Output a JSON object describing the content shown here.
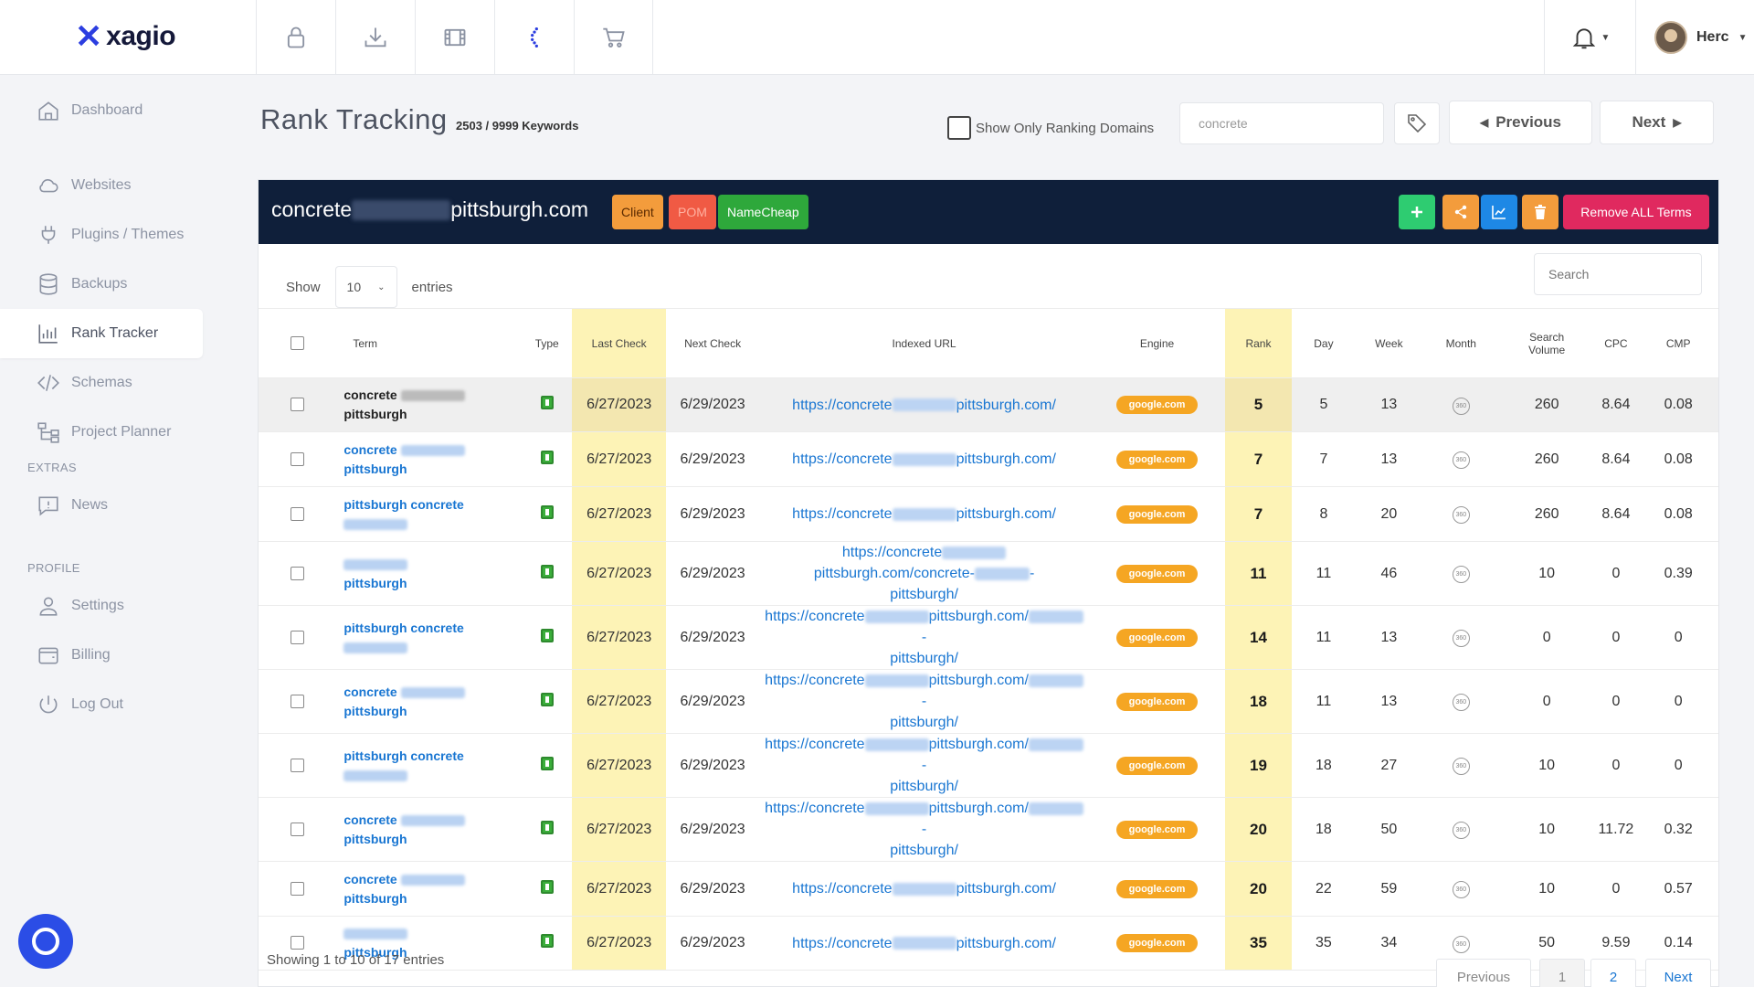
{
  "brand": {
    "name": "xagio"
  },
  "topbar": {
    "icons": [
      "lock-icon",
      "download-icon",
      "film-icon",
      "spinner-icon",
      "cart-icon"
    ],
    "user_name": "Herc"
  },
  "sidebar": {
    "items": [
      {
        "label": "Dashboard",
        "icon": "home-icon"
      },
      {
        "label": "Websites",
        "icon": "cloud-icon"
      },
      {
        "label": "Plugins / Themes",
        "icon": "plug-icon"
      },
      {
        "label": "Backups",
        "icon": "database-icon"
      },
      {
        "label": "Rank Tracker",
        "icon": "chart-icon",
        "active": true
      },
      {
        "label": "Schemas",
        "icon": "code-icon"
      },
      {
        "label": "Project Planner",
        "icon": "sitemap-icon"
      }
    ],
    "extras_label": "EXTRAS",
    "extras": [
      {
        "label": "News",
        "icon": "alert-icon"
      }
    ],
    "profile_label": "PROFILE",
    "profile": [
      {
        "label": "Settings",
        "icon": "user-icon"
      },
      {
        "label": "Billing",
        "icon": "wallet-icon"
      },
      {
        "label": "Log Out",
        "icon": "power-icon"
      }
    ]
  },
  "header": {
    "title": "Rank Tracking",
    "keyword_count": "2503 / 9999 Keywords",
    "ranking_toggle_label": "Show Only Ranking Domains",
    "filter_value": "concrete",
    "previous_label": "Previous",
    "next_label": "Next"
  },
  "panel": {
    "domain_prefix": "concrete",
    "domain_suffix": "pittsburgh.com",
    "badges": {
      "client": "Client",
      "pom": "POM",
      "namecheap": "NameCheap"
    },
    "remove_label": "Remove ALL Terms",
    "show_label": "Show",
    "entries_value": "10",
    "entries_label": "entries",
    "search_placeholder": "Search",
    "showing": "Showing 1 to 10 of 17 entries",
    "pagination": {
      "previous": "Previous",
      "page1": "1",
      "page2": "2",
      "next": "Next"
    }
  },
  "table": {
    "columns": {
      "term": "Term",
      "type": "Type",
      "last_check": "Last Check",
      "next_check": "Next Check",
      "indexed_url": "Indexed URL",
      "engine": "Engine",
      "rank": "Rank",
      "day": "Day",
      "week": "Week",
      "month": "Month",
      "search_volume": "Search Volume",
      "cpc": "CPC",
      "cmp": "CMP"
    },
    "url_prefix": "https://concrete",
    "url_suffix_root": "pittsburgh.com/",
    "url_line2": "pittsburgh/",
    "engine_label": "google.com",
    "month_text": "360",
    "rows": [
      {
        "term_a": "concrete",
        "term_b": "pittsburgh",
        "last": "6/27/2023",
        "next": "6/29/2023",
        "url_a": "pittsburgh.com/",
        "url_b": "",
        "rank": "5",
        "day": "5",
        "week": "13",
        "sv": "260",
        "cpc": "8.64",
        "cmp": "0.08"
      },
      {
        "term_a": "concrete",
        "term_b": "pittsburgh",
        "last": "6/27/2023",
        "next": "6/29/2023",
        "url_a": "pittsburgh.com/",
        "url_b": "",
        "rank": "7",
        "day": "7",
        "week": "13",
        "sv": "260",
        "cpc": "8.64",
        "cmp": "0.08"
      },
      {
        "term_a": "pittsburgh concrete",
        "term_b": "",
        "last": "6/27/2023",
        "next": "6/29/2023",
        "url_a": "pittsburgh.com/",
        "url_b": "",
        "rank": "7",
        "day": "8",
        "week": "20",
        "sv": "260",
        "cpc": "8.64",
        "cmp": "0.08"
      },
      {
        "term_a": "",
        "term_b": "pittsburgh",
        "last": "6/27/2023",
        "next": "6/29/2023",
        "url_a": "pittsburgh.com/concrete-",
        "url_b": "pittsburgh/",
        "rank": "11",
        "day": "11",
        "week": "46",
        "sv": "10",
        "cpc": "0",
        "cmp": "0.39"
      },
      {
        "term_a": "pittsburgh concrete",
        "term_b": "",
        "last": "6/27/2023",
        "next": "6/29/2023",
        "url_a": "pittsburgh.com/",
        "url_b": "pittsburgh/",
        "rank": "14",
        "day": "11",
        "week": "13",
        "sv": "0",
        "cpc": "0",
        "cmp": "0"
      },
      {
        "term_a": "concrete",
        "term_b": "pittsburgh",
        "last": "6/27/2023",
        "next": "6/29/2023",
        "url_a": "pittsburgh.com/",
        "url_b": "pittsburgh/",
        "rank": "18",
        "day": "11",
        "week": "13",
        "sv": "0",
        "cpc": "0",
        "cmp": "0"
      },
      {
        "term_a": "pittsburgh concrete",
        "term_b": "",
        "last": "6/27/2023",
        "next": "6/29/2023",
        "url_a": "pittsburgh.com/",
        "url_b": "pittsburgh/",
        "rank": "19",
        "day": "18",
        "week": "27",
        "sv": "10",
        "cpc": "0",
        "cmp": "0"
      },
      {
        "term_a": "concrete",
        "term_b": "pittsburgh",
        "last": "6/27/2023",
        "next": "6/29/2023",
        "url_a": "pittsburgh.com/",
        "url_b": "pittsburgh/",
        "rank": "20",
        "day": "18",
        "week": "50",
        "sv": "10",
        "cpc": "11.72",
        "cmp": "0.32"
      },
      {
        "term_a": "concrete",
        "term_b": "pittsburgh",
        "last": "6/27/2023",
        "next": "6/29/2023",
        "url_a": "pittsburgh.com/",
        "url_b": "",
        "rank": "20",
        "day": "22",
        "week": "59",
        "sv": "10",
        "cpc": "0",
        "cmp": "0.57"
      },
      {
        "term_a": "",
        "term_b": "pittsburgh",
        "last": "6/27/2023",
        "next": "6/29/2023",
        "url_a": "pittsburgh.com/",
        "url_b": "",
        "rank": "35",
        "day": "35",
        "week": "34",
        "sv": "50",
        "cpc": "9.59",
        "cmp": "0.14"
      }
    ]
  },
  "colors": {
    "brand": "#2c3ee0",
    "panel_header": "#0f1f3a",
    "highlight_column": "#fdf3b6",
    "link": "#1976d2",
    "engine_badge": "#f5a623",
    "remove_button": "#e0295f",
    "add_button": "#2ecc71",
    "share_button": "#f39c3c",
    "chart_button": "#1e88e5",
    "delete_button": "#f39c3c"
  }
}
